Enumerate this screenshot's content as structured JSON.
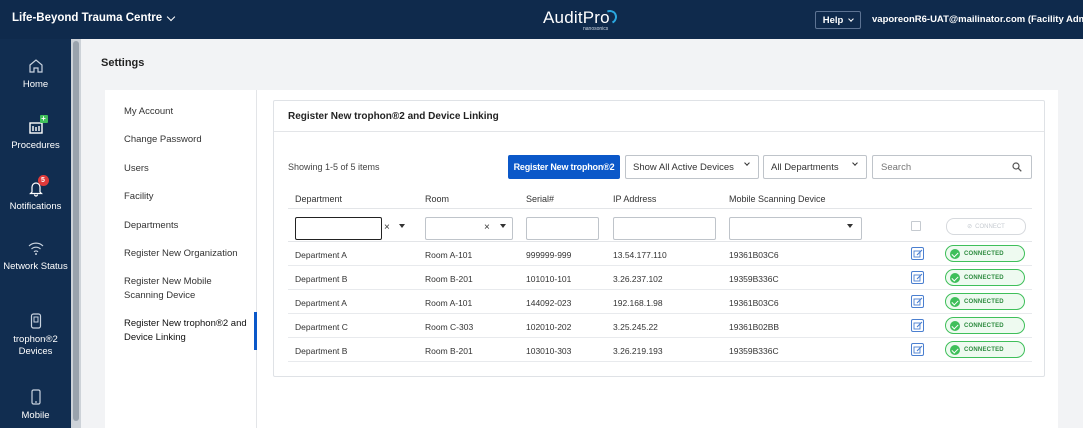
{
  "header": {
    "facility": "Life-Beyond Trauma Centre",
    "logo_main": "AuditPro",
    "logo_sub": "nanosonics",
    "help_label": "Help",
    "user_label": "vaporeonR6-UAT@mailinator.com (Facility Admin)"
  },
  "sidenav": {
    "items": [
      {
        "label": "Home",
        "icon": "home-icon"
      },
      {
        "label": "Procedures",
        "icon": "procedures-icon"
      },
      {
        "label": "Notifications",
        "icon": "bell-icon",
        "badge": "5"
      },
      {
        "label": "Network Status",
        "icon": "wifi-icon"
      },
      {
        "label": "trophon®2 Devices",
        "icon": "device-icon"
      },
      {
        "label": "Mobile",
        "icon": "mobile-icon"
      }
    ]
  },
  "page": {
    "title": "Settings"
  },
  "settings_menu": {
    "items": [
      "My Account",
      "Change Password",
      "Users",
      "Facility",
      "Departments",
      "Register New Organization",
      "Register New Mobile Scanning Device",
      "Register New trophon®2 and Device Linking"
    ],
    "active_index": 7
  },
  "panel": {
    "title": "Register New trophon®2 and Device Linking",
    "showing": "Showing 1-5 of 5 items",
    "register_button": "Register New trophon®2",
    "device_filter": "Show All Active Devices",
    "department_filter": "All Departments",
    "search_placeholder": "Search",
    "connect_disabled_label": "CONNECT"
  },
  "table": {
    "columns": [
      "Department",
      "Room",
      "Serial#",
      "IP Address",
      "Mobile Scanning Device"
    ],
    "rows": [
      {
        "department": "Department A",
        "room": "Room A-101",
        "serial": "999999-999",
        "ip": "13.54.177.110",
        "device": "19361B03C6",
        "status": "CONNECTED"
      },
      {
        "department": "Department B",
        "room": "Room B-201",
        "serial": "101010-101",
        "ip": "3.26.237.102",
        "device": "19359B336C",
        "status": "CONNECTED"
      },
      {
        "department": "Department A",
        "room": "Room A-101",
        "serial": "144092-023",
        "ip": "192.168.1.98",
        "device": "19361B03C6",
        "status": "CONNECTED"
      },
      {
        "department": "Department C",
        "room": "Room C-303",
        "serial": "102010-202",
        "ip": "3.25.245.22",
        "device": "19361B02BB",
        "status": "CONNECTED"
      },
      {
        "department": "Department B",
        "room": "Room B-201",
        "serial": "103010-303",
        "ip": "3.26.219.193",
        "device": "19359B336C",
        "status": "CONNECTED"
      }
    ]
  },
  "colors": {
    "topbar": "#0f2a4c",
    "sidenav": "#112d50",
    "primary": "#0b58c9",
    "connected": "#3fbf5a"
  }
}
